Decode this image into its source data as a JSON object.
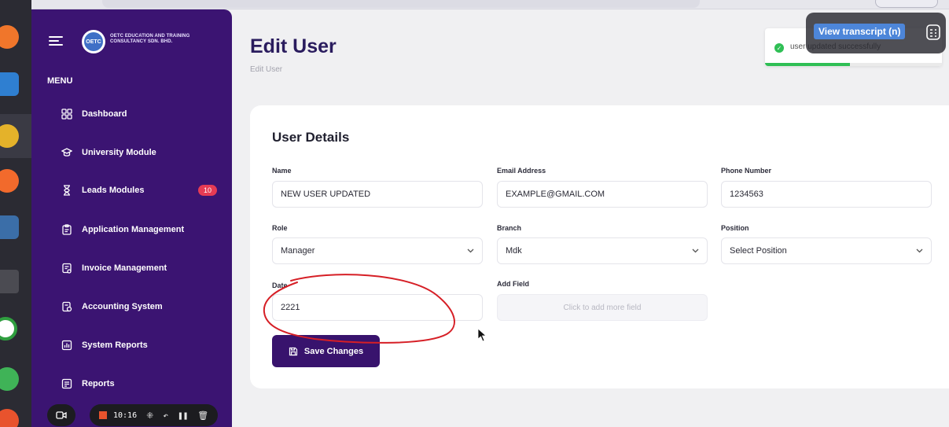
{
  "sidebar": {
    "brand_name": "OETC EDUCATION AND TRAINING CONSULTANCY SDN. BHD.",
    "logo_text": "OETC",
    "menu_heading": "MENU",
    "items": [
      {
        "label": "Dashboard",
        "icon": "grid-icon"
      },
      {
        "label": "University Module",
        "icon": "graduation-cap-icon"
      },
      {
        "label": "Leads Modules",
        "icon": "hourglass-icon",
        "badge": "10"
      },
      {
        "label": "Application Management",
        "icon": "clipboard-icon"
      },
      {
        "label": "Invoice Management",
        "icon": "invoice-icon"
      },
      {
        "label": "Accounting System",
        "icon": "accounting-icon"
      },
      {
        "label": "System Reports",
        "icon": "report-chart-icon"
      },
      {
        "label": "Reports",
        "icon": "reports-icon"
      }
    ]
  },
  "page": {
    "title": "Edit User",
    "breadcrumb": "Edit User"
  },
  "toast": {
    "message": "user updated successfully",
    "progress_fraction": 0.48,
    "accent_color": "#2fbf55"
  },
  "overlay": {
    "transcript_label": "View transcript (n)",
    "recording_time": "10:16"
  },
  "form": {
    "section_title": "User Details",
    "name": {
      "label": "Name",
      "value": "NEW USER UPDATED"
    },
    "email": {
      "label": "Email Address",
      "value": "EXAMPLE@GMAIL.COM"
    },
    "phone": {
      "label": "Phone Number",
      "value": "1234563"
    },
    "role": {
      "label": "Role",
      "value": "Manager"
    },
    "branch": {
      "label": "Branch",
      "value": "Mdk"
    },
    "position": {
      "label": "Position",
      "value": "Select Position"
    },
    "date": {
      "label": "Date",
      "value": "2221"
    },
    "add_field": {
      "label": "Add Field",
      "value": "Click to add more field"
    },
    "save_label": "Save Changes"
  },
  "colors": {
    "sidebar_bg": "#3b1472",
    "primary_button": "#38136d",
    "badge": "#e63b54",
    "annotation": "#d61f26"
  }
}
